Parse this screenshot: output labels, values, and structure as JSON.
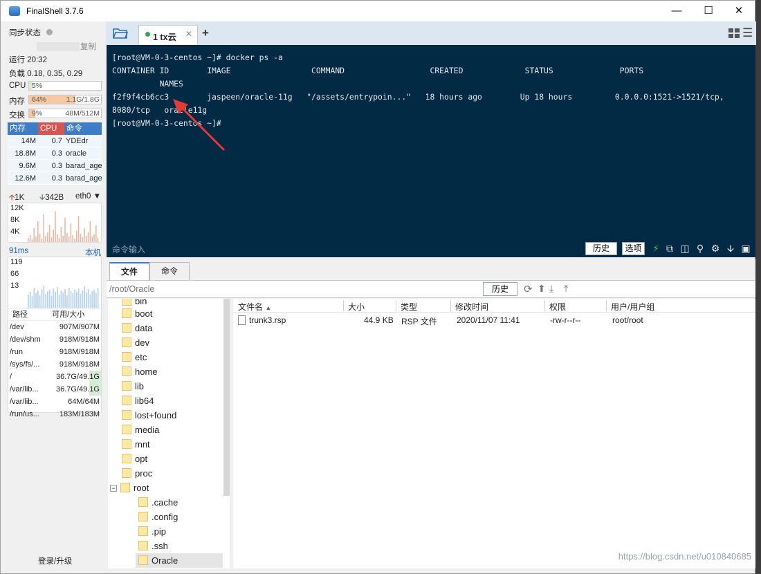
{
  "window": {
    "title": "FinalShell 3.7.6"
  },
  "left": {
    "sync_label": "同步状态",
    "copy_label": "复制",
    "uptime": "运行 20:32",
    "load": "负载 0.18, 0.35, 0.29",
    "cpu": {
      "label": "CPU",
      "percent_text": "5%",
      "level": 0.05
    },
    "mem": {
      "label": "内存",
      "percent_text": "64%",
      "value": "1.1G/1.8G",
      "level": 0.64
    },
    "swap": {
      "label": "交换",
      "percent_text": "9%",
      "value": "48M/512M",
      "level": 0.09
    },
    "proc_headers": {
      "mem": "内存",
      "cpu": "CPU",
      "cmd": "命令"
    },
    "processes": [
      {
        "mem": "14M",
        "cpu": "0.7",
        "cmd": "YDEdr"
      },
      {
        "mem": "18.8M",
        "cpu": "0.3",
        "cmd": "oracle"
      },
      {
        "mem": "9.6M",
        "cpu": "0.3",
        "cmd": "barad_age"
      },
      {
        "mem": "12.6M",
        "cpu": "0.3",
        "cmd": "barad_age"
      }
    ],
    "net": {
      "up": "1K",
      "down": "342B",
      "iface": "eth0",
      "scale": [
        "12K",
        "8K",
        "4K"
      ]
    },
    "ping": {
      "ms": "91ms",
      "host": "本机",
      "scale": [
        "119",
        "66",
        "13"
      ]
    },
    "disk_headers": {
      "path": "路径",
      "avail": "可用/大小"
    },
    "disks": [
      {
        "path": "/dev",
        "avail": "907M/907M"
      },
      {
        "path": "/dev/shm",
        "avail": "918M/918M"
      },
      {
        "path": "/run",
        "avail": "918M/918M"
      },
      {
        "path": "/sys/fs/...",
        "avail": "918M/918M"
      },
      {
        "path": "/",
        "avail": "36.7G/49.1G"
      },
      {
        "path": "/var/lib...",
        "avail": "36.7G/49.1G"
      },
      {
        "path": "/var/lib...",
        "avail": "64M/64M"
      },
      {
        "path": "/run/us...",
        "avail": "183M/183M"
      }
    ],
    "login_label": "登录/升级"
  },
  "tabs": [
    {
      "label": "1 tx云"
    }
  ],
  "terminal": {
    "lines": [
      "[root@VM-0-3-centos ~]# docker ps -a",
      "CONTAINER ID        IMAGE                 COMMAND                  CREATED             STATUS              PORTS",
      "          NAMES",
      "f2f9f4cb6cc3        jaspeen/oracle-11g   \"/assets/entrypoin...\"   18 hours ago        Up 18 hours         0.0.0.0:1521->1521/tcp,",
      "8080/tcp   oracle11g",
      "[root@VM-0-3-centos ~]#"
    ],
    "cmd_input_label": "命令输入",
    "history_btn": "历史",
    "options_btn": "选项"
  },
  "file_tabs": [
    "文件",
    "命令"
  ],
  "path": {
    "current": "/root/Oracle",
    "history_btn": "历史"
  },
  "tree": [
    {
      "name": "bin",
      "depth": 0
    },
    {
      "name": "boot",
      "depth": 0
    },
    {
      "name": "data",
      "depth": 0
    },
    {
      "name": "dev",
      "depth": 0
    },
    {
      "name": "etc",
      "depth": 0
    },
    {
      "name": "home",
      "depth": 0
    },
    {
      "name": "lib",
      "depth": 0
    },
    {
      "name": "lib64",
      "depth": 0
    },
    {
      "name": "lost+found",
      "depth": 0
    },
    {
      "name": "media",
      "depth": 0
    },
    {
      "name": "mnt",
      "depth": 0
    },
    {
      "name": "opt",
      "depth": 0
    },
    {
      "name": "proc",
      "depth": 0
    },
    {
      "name": "root",
      "depth": 0
    },
    {
      "name": ".cache",
      "depth": 1
    },
    {
      "name": ".config",
      "depth": 1
    },
    {
      "name": ".pip",
      "depth": 1
    },
    {
      "name": ".ssh",
      "depth": 1
    },
    {
      "name": "Oracle",
      "depth": 1
    }
  ],
  "file_headers": {
    "name": "文件名",
    "size": "大小",
    "type": "类型",
    "mtime": "修改时间",
    "perm": "权限",
    "owner": "用户/用户组"
  },
  "files": [
    {
      "name": "trunk3.rsp",
      "size": "44.9 KB",
      "type": "RSP 文件",
      "mtime": "2020/11/07 11:41",
      "perm": "-rw-r--r--",
      "owner": "root/root"
    }
  ],
  "watermark": "https://blog.csdn.net/u010840685"
}
